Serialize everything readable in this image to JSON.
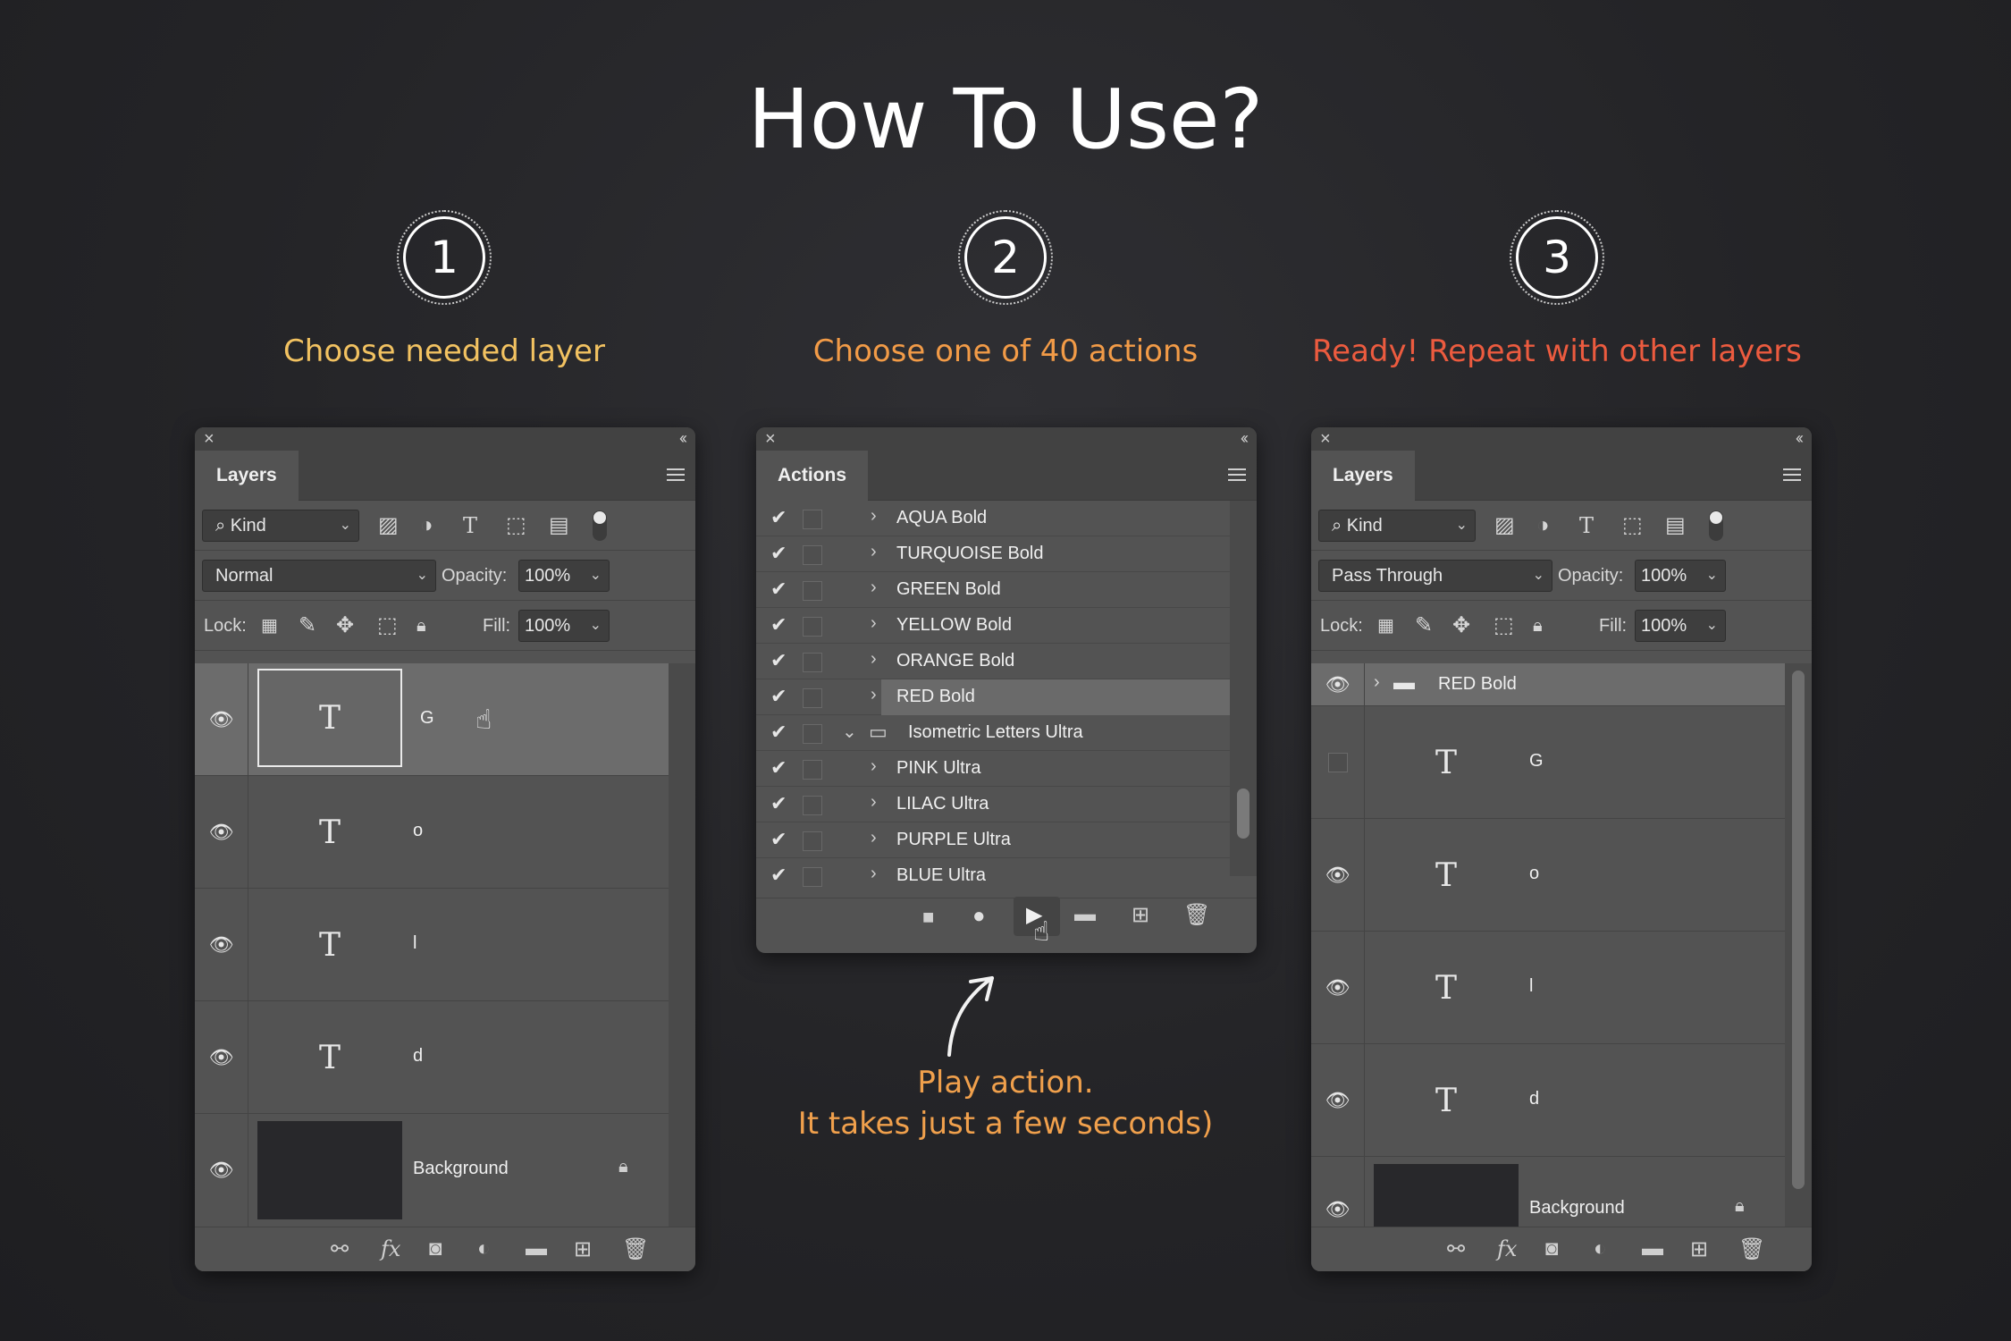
{
  "title": "How To Use?",
  "steps": [
    {
      "num": "1",
      "caption": "Choose needed layer",
      "color": "#f2c261"
    },
    {
      "num": "2",
      "caption": "Choose one of 40 actions",
      "color": "#f29b47"
    },
    {
      "num": "3",
      "caption": "Ready! Repeat with other layers",
      "color": "#ec5b3f"
    }
  ],
  "hint": {
    "line1": "Play action.",
    "line2": "It takes just a few seconds)",
    "color": "#f0a04c"
  },
  "panel_left": {
    "tab": "Layers",
    "filter": "Kind",
    "blend": "Normal",
    "opacity_label": "Opacity:",
    "opacity": "100%",
    "lock_label": "Lock:",
    "fill_label": "Fill:",
    "fill": "100%",
    "layers": [
      {
        "name": "G"
      },
      {
        "name": "o"
      },
      {
        "name": "l"
      },
      {
        "name": "d"
      },
      {
        "name": "Background"
      }
    ]
  },
  "panel_actions": {
    "tab": "Actions",
    "items": [
      {
        "name": "AQUA Bold"
      },
      {
        "name": "TURQUOISE Bold"
      },
      {
        "name": "GREEN Bold"
      },
      {
        "name": "YELLOW Bold"
      },
      {
        "name": "ORANGE Bold"
      },
      {
        "name": "RED Bold"
      },
      {
        "name": "Isometric Letters Ultra"
      },
      {
        "name": "PINK Ultra"
      },
      {
        "name": "LILAC Ultra"
      },
      {
        "name": "PURPLE Ultra"
      },
      {
        "name": "BLUE Ultra"
      }
    ]
  },
  "panel_right": {
    "tab": "Layers",
    "filter": "Kind",
    "blend": "Pass Through",
    "opacity_label": "Opacity:",
    "opacity": "100%",
    "lock_label": "Lock:",
    "fill_label": "Fill:",
    "fill": "100%",
    "group": "RED Bold",
    "layers": [
      {
        "name": "G"
      },
      {
        "name": "o"
      },
      {
        "name": "l"
      },
      {
        "name": "d"
      },
      {
        "name": "Background"
      }
    ]
  }
}
